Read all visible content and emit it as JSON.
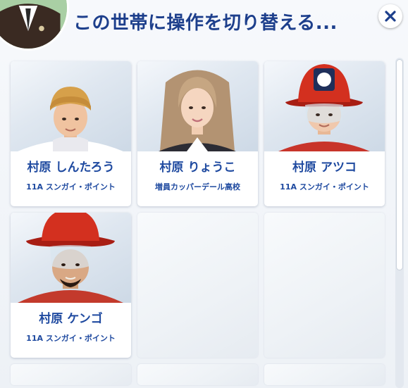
{
  "dialog": {
    "title": "この世帯に操作を切り替える..."
  },
  "icons": {
    "close": "close-icon",
    "household_avatar": "sim-avatar"
  },
  "colors": {
    "title": "#1d3f8c",
    "card_text": "#1f4aa0"
  },
  "sims": [
    {
      "name": "村原 しんたろう",
      "place": "11A スンガイ・ポイント"
    },
    {
      "name": "村原 りょうこ",
      "place": "増員カッパーデール高校"
    },
    {
      "name": "村原 アツコ",
      "place": "11A スンガイ・ポイント"
    },
    {
      "name": "村原 ケンゴ",
      "place": "11A スンガイ・ポイント"
    }
  ]
}
